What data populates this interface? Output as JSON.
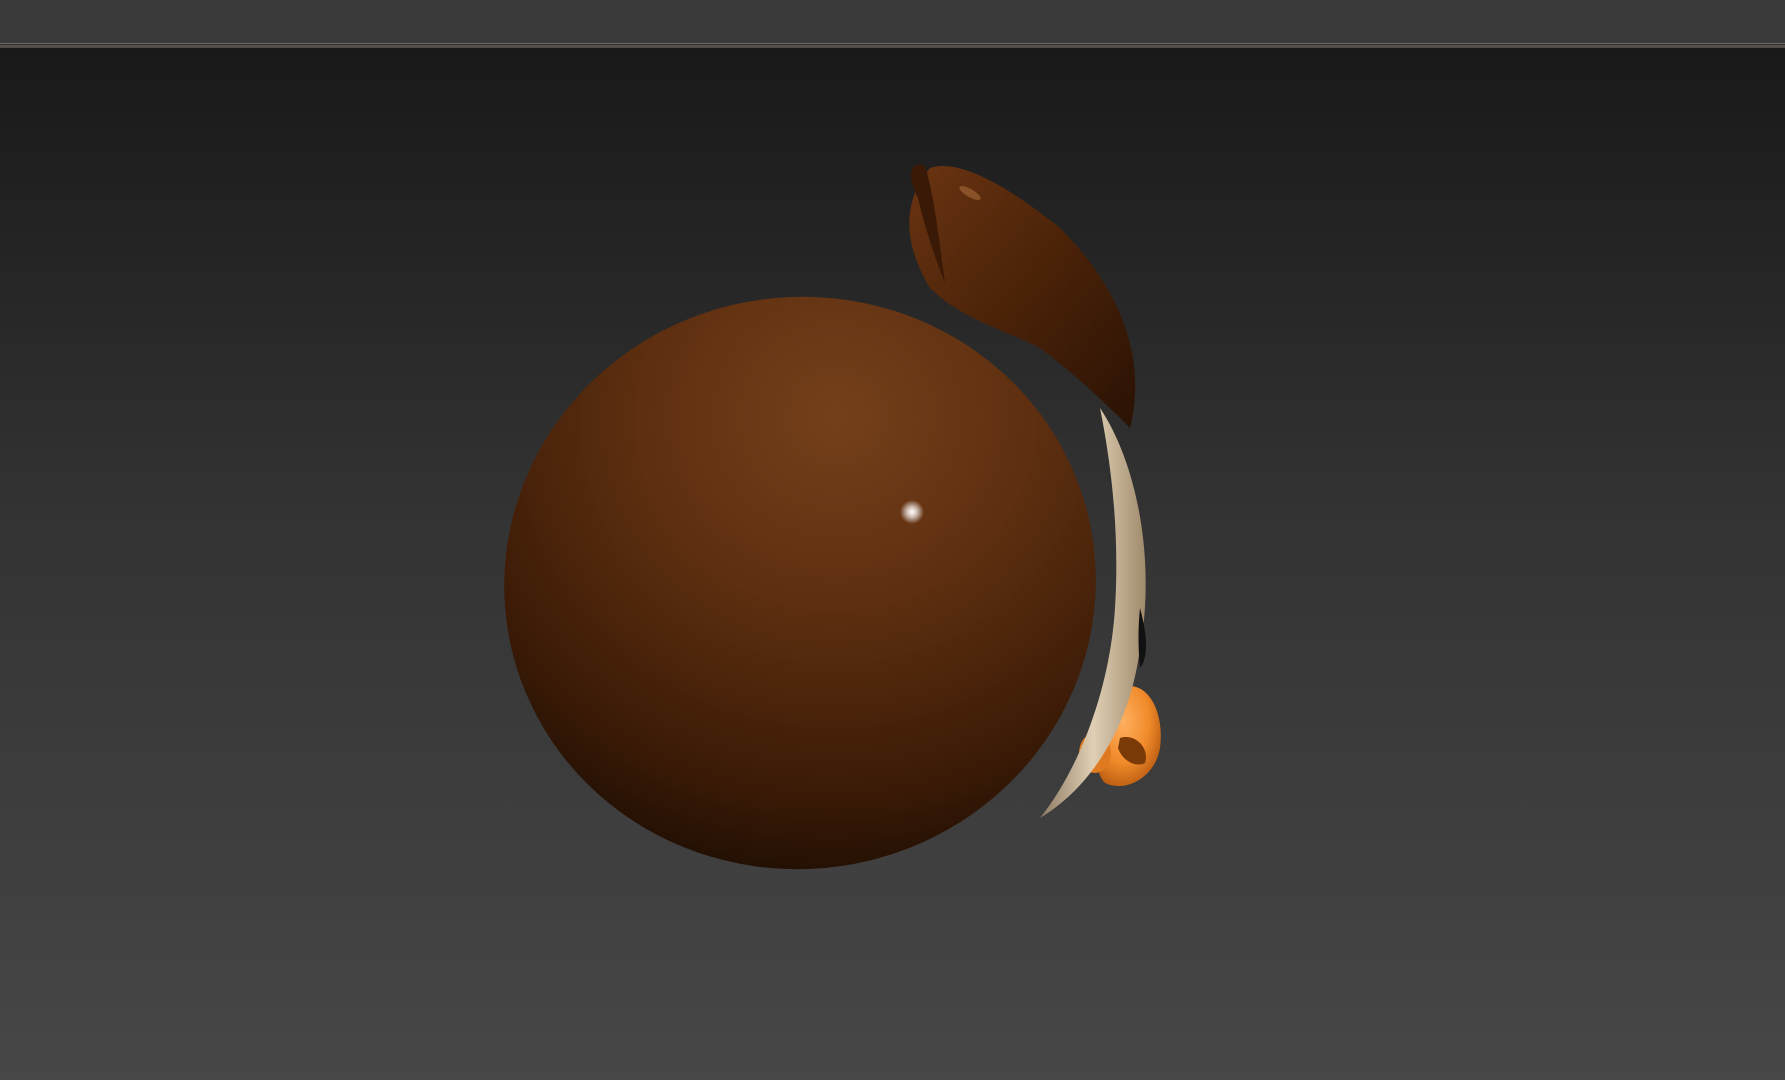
{
  "viewport": {
    "background_top": "#191919",
    "background_bottom": "#474747"
  },
  "model": {
    "body_color": "#5a2a0c",
    "body_highlight": "#74401a",
    "tail_color": "#4a2208",
    "belly_color": "#c9b59a",
    "beak_color": "#f08a2a",
    "specular_color": "#ffffff"
  }
}
